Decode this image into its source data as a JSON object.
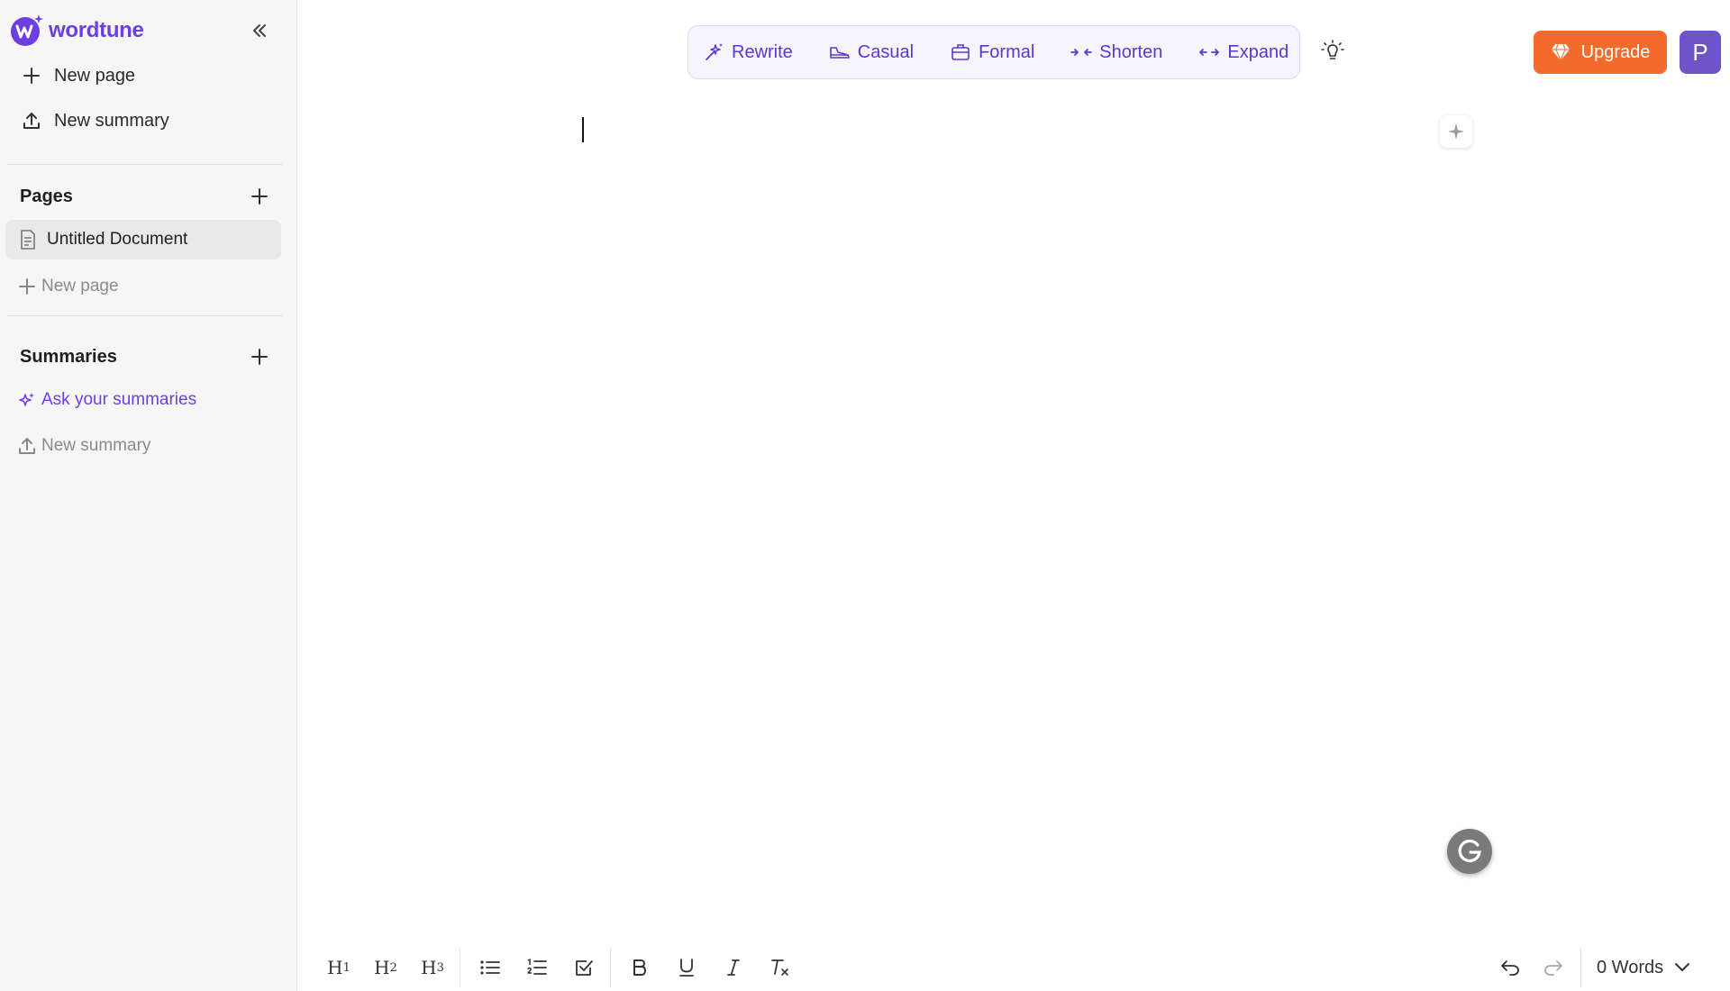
{
  "app": {
    "name": "wordtune",
    "brand_color": "#6b3fe0",
    "accent_orange": "#f26b2a"
  },
  "sidebar": {
    "new_page": "New page",
    "new_summary": "New summary",
    "pages_title": "Pages",
    "pages": [
      {
        "label": "Untitled Document"
      }
    ],
    "pages_new": "New page",
    "summaries_title": "Summaries",
    "ask_summaries": "Ask your summaries",
    "summaries_new": "New summary"
  },
  "toolbar": {
    "rewrite": "Rewrite",
    "casual": "Casual",
    "formal": "Formal",
    "shorten": "Shorten",
    "expand": "Expand"
  },
  "header": {
    "upgrade": "Upgrade",
    "avatar_initial": "P"
  },
  "format_bar": {
    "h1": "H",
    "h1_sub": "1",
    "h2": "H",
    "h2_sub": "2",
    "h3": "H",
    "h3_sub": "3",
    "word_count": "0 Words"
  },
  "icons": [
    "double-chevron-left-icon",
    "plus-icon",
    "upload-icon",
    "document-icon",
    "sparkle-icon",
    "rewrite-sparkle-icon",
    "casual-shoe-icon",
    "briefcase-icon",
    "shorten-arrows-icon",
    "expand-arrows-icon",
    "lightbulb-icon",
    "diamond-icon",
    "grammarly-icon",
    "bullet-list-icon",
    "numbered-list-icon",
    "checkbox-icon",
    "bold-icon",
    "underline-icon",
    "italic-icon",
    "clear-format-icon",
    "undo-icon",
    "redo-icon",
    "chevron-down-icon"
  ]
}
